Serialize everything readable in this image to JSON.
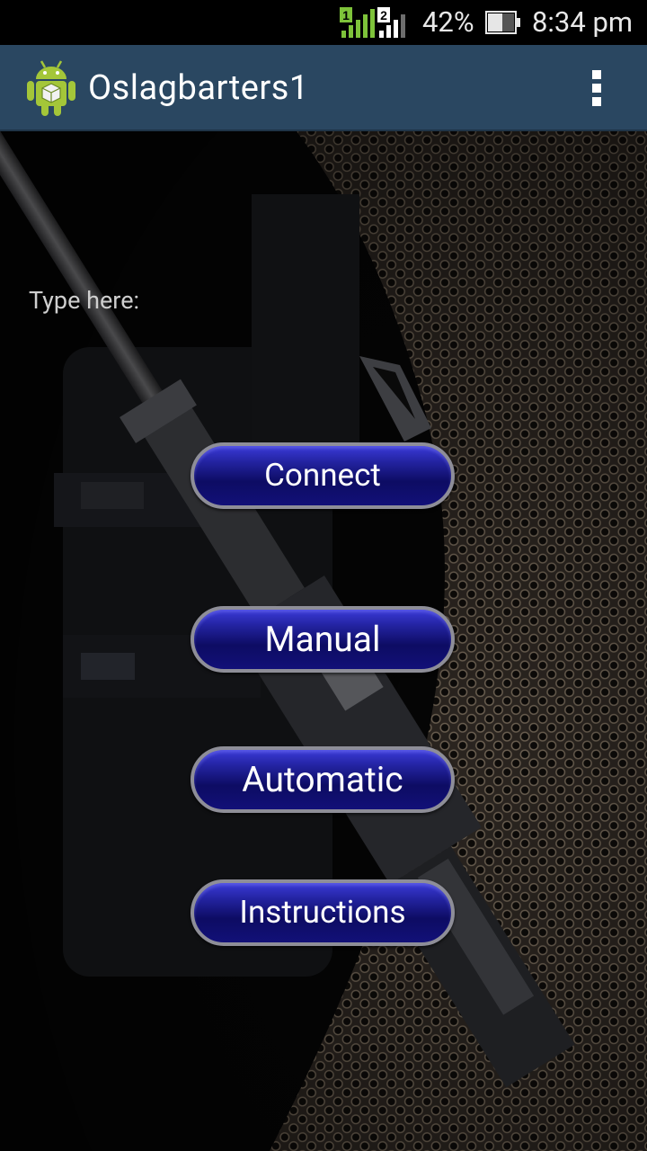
{
  "status_bar": {
    "battery_percent": "42%",
    "time": "8:34 pm",
    "sim1_label": "1",
    "sim2_label": "2"
  },
  "action_bar": {
    "title": "Oslagbarters1",
    "icon": "android-robot-icon",
    "overflow_icon": "overflow-menu-icon"
  },
  "main": {
    "hint_label": "Type here:",
    "buttons": {
      "connect": "Connect",
      "manual": "Manual",
      "automatic": "Automatic",
      "instructions": "Instructions"
    }
  },
  "colors": {
    "action_bar": "#2a4761",
    "button_fill": "#14127a",
    "button_border": "#8e8e98",
    "sim1_signal": "#7ec33a"
  }
}
